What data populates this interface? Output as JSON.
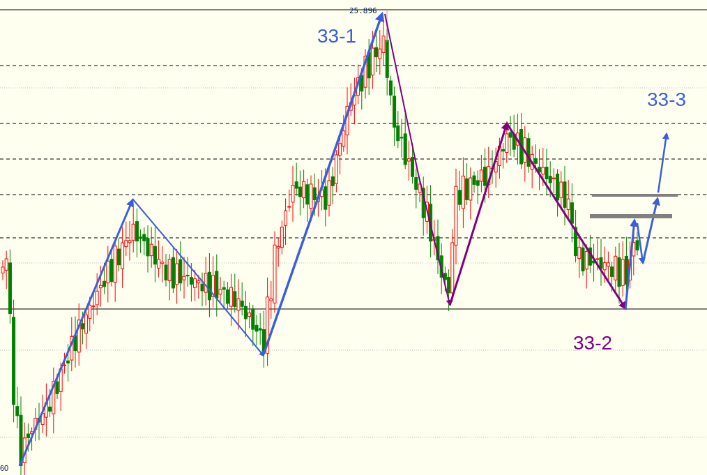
{
  "chart": {
    "high_label": "25.896",
    "low_label": "60",
    "waves": [
      {
        "label": "33-1",
        "color": "#3b5fd8"
      },
      {
        "label": "33-2",
        "color": "#800080"
      },
      {
        "label": "33-3",
        "color": "#3b5fd8"
      }
    ]
  }
}
